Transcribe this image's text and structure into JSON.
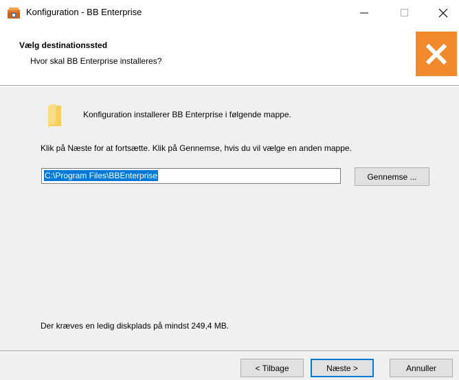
{
  "window": {
    "title": "Konfiguration - BB Enterprise",
    "minimize_glyph": "—",
    "maximize_glyph": "☐",
    "close_glyph": "✕"
  },
  "header": {
    "title": "Vælg destinationssted",
    "subtitle": "Hvor skal BB Enterprise installeres?"
  },
  "body": {
    "info": "Konfiguration installerer BB Enterprise i følgende mappe.",
    "instruction": "Klik på Næste for at fortsætte. Klik på Gennemse, hvis du vil vælge en anden mappe.",
    "path_value": "C:\\Program Files\\BBEnterprise",
    "browse_label": "Gennemse ...",
    "space_required": "Der kræves en ledig diskplads på mindst 249,4 MB."
  },
  "footer": {
    "back_label": "< Tilbage",
    "next_label": "Næste >",
    "cancel_label": "Annuller"
  },
  "colors": {
    "brand_orange": "#f08a2c",
    "selection_blue": "#0078d7"
  },
  "icons": {
    "app": "installer-box-icon",
    "brand": "x-logo-icon",
    "folder": "folder-icon"
  }
}
